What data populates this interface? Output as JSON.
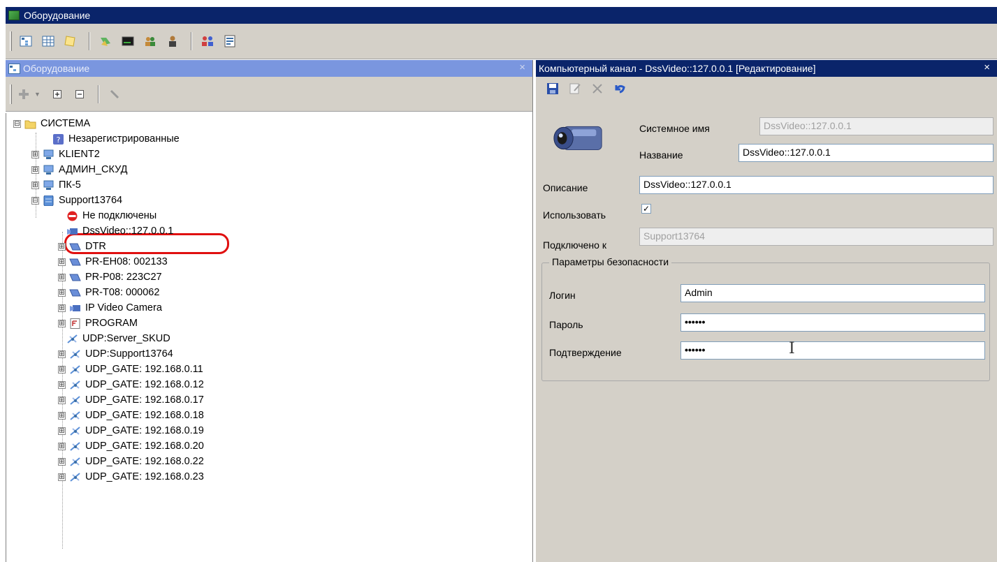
{
  "window": {
    "title": "Оборудование",
    "icon": "equipment-icon"
  },
  "main_toolbar": {
    "icons": [
      "tree-icon",
      "grid-icon",
      "note-icon",
      "monitor-icon",
      "camera-dark-icon",
      "users-icon",
      "person-icon",
      "group-icon",
      "report-icon"
    ]
  },
  "left_panel": {
    "title": "Оборудование",
    "close": "×",
    "toolbar_icons": [
      "add-icon",
      "dropdown-arrow-icon",
      "expand-all-icon",
      "collapse-all-icon",
      "wrench-icon"
    ],
    "tree": [
      {
        "label": "СИСТЕМА",
        "icon": "folder-icon",
        "expander": "⊟"
      },
      {
        "label": "Незарегистрированные",
        "icon": "question-icon",
        "expander": ""
      },
      {
        "label": "KLIENT2",
        "icon": "computer-icon",
        "expander": "⊞"
      },
      {
        "label": "АДМИН_СКУД",
        "icon": "computer-icon",
        "expander": "⊞"
      },
      {
        "label": "ПК-5",
        "icon": "computer-icon",
        "expander": "⊞"
      },
      {
        "label": "Support13764",
        "icon": "server-icon",
        "expander": "⊟"
      },
      {
        "label": "Не подключены",
        "icon": "no-entry-icon",
        "expander": ""
      },
      {
        "label": "DssVideo::127.0.0.1",
        "icon": "video-camera-icon",
        "expander": ""
      },
      {
        "label": "DTR",
        "icon": "device-icon",
        "expander": "⊞"
      },
      {
        "label": "PR-EH08: 002133",
        "icon": "device-icon",
        "expander": "⊞"
      },
      {
        "label": "PR-P08: 223C27",
        "icon": "device-icon",
        "expander": "⊞"
      },
      {
        "label": "PR-T08: 000062",
        "icon": "device-icon",
        "expander": "⊞"
      },
      {
        "label": "IP Video Camera",
        "icon": "video-camera-icon",
        "expander": "⊞"
      },
      {
        "label": "PROGRAM",
        "icon": "program-icon",
        "expander": "⊞"
      },
      {
        "label": "UDP:Server_SKUD",
        "icon": "network-icon",
        "expander": ""
      },
      {
        "label": "UDP:Support13764",
        "icon": "network-icon",
        "expander": "⊞"
      },
      {
        "label": "UDP_GATE: 192.168.0.11",
        "icon": "network-icon",
        "expander": "⊞"
      },
      {
        "label": "UDP_GATE: 192.168.0.12",
        "icon": "network-icon",
        "expander": "⊞"
      },
      {
        "label": "UDP_GATE: 192.168.0.17",
        "icon": "network-icon",
        "expander": "⊞"
      },
      {
        "label": "UDP_GATE: 192.168.0.18",
        "icon": "network-icon",
        "expander": "⊞"
      },
      {
        "label": "UDP_GATE: 192.168.0.19",
        "icon": "network-icon",
        "expander": "⊞"
      },
      {
        "label": "UDP_GATE: 192.168.0.20",
        "icon": "network-icon",
        "expander": "⊞"
      },
      {
        "label": "UDP_GATE: 192.168.0.22",
        "icon": "network-icon",
        "expander": "⊞"
      },
      {
        "label": "UDP_GATE: 192.168.0.23",
        "icon": "network-icon",
        "expander": "⊞"
      }
    ]
  },
  "right_panel": {
    "title": "Компьютерный канал - DssVideo::127.0.0.1 [Редактирование]",
    "close": "×",
    "toolbar_icons": [
      "save-icon",
      "edit-icon",
      "delete-icon",
      "undo-icon"
    ],
    "form": {
      "system_name_label": "Системное имя",
      "system_name_value": "DssVideo::127.0.0.1",
      "name_label": "Название",
      "name_value": "DssVideo::127.0.0.1",
      "description_label": "Описание",
      "description_value": "DssVideo::127.0.0.1",
      "use_label": "Использовать",
      "use_checked": "✓",
      "connected_label": "Подключено к",
      "connected_value": "Support13764"
    },
    "security": {
      "legend": "Параметры безопасности",
      "login_label": "Логин",
      "login_value": "Admin",
      "password_label": "Пароль",
      "password_value": "••••••",
      "confirm_label": "Подтверждение",
      "confirm_value": "••••••"
    }
  },
  "colors": {
    "title_active": "#0a246a",
    "title_inactive": "#7a96df",
    "face": "#d4d0c8",
    "highlight_ring": "#e01010"
  }
}
